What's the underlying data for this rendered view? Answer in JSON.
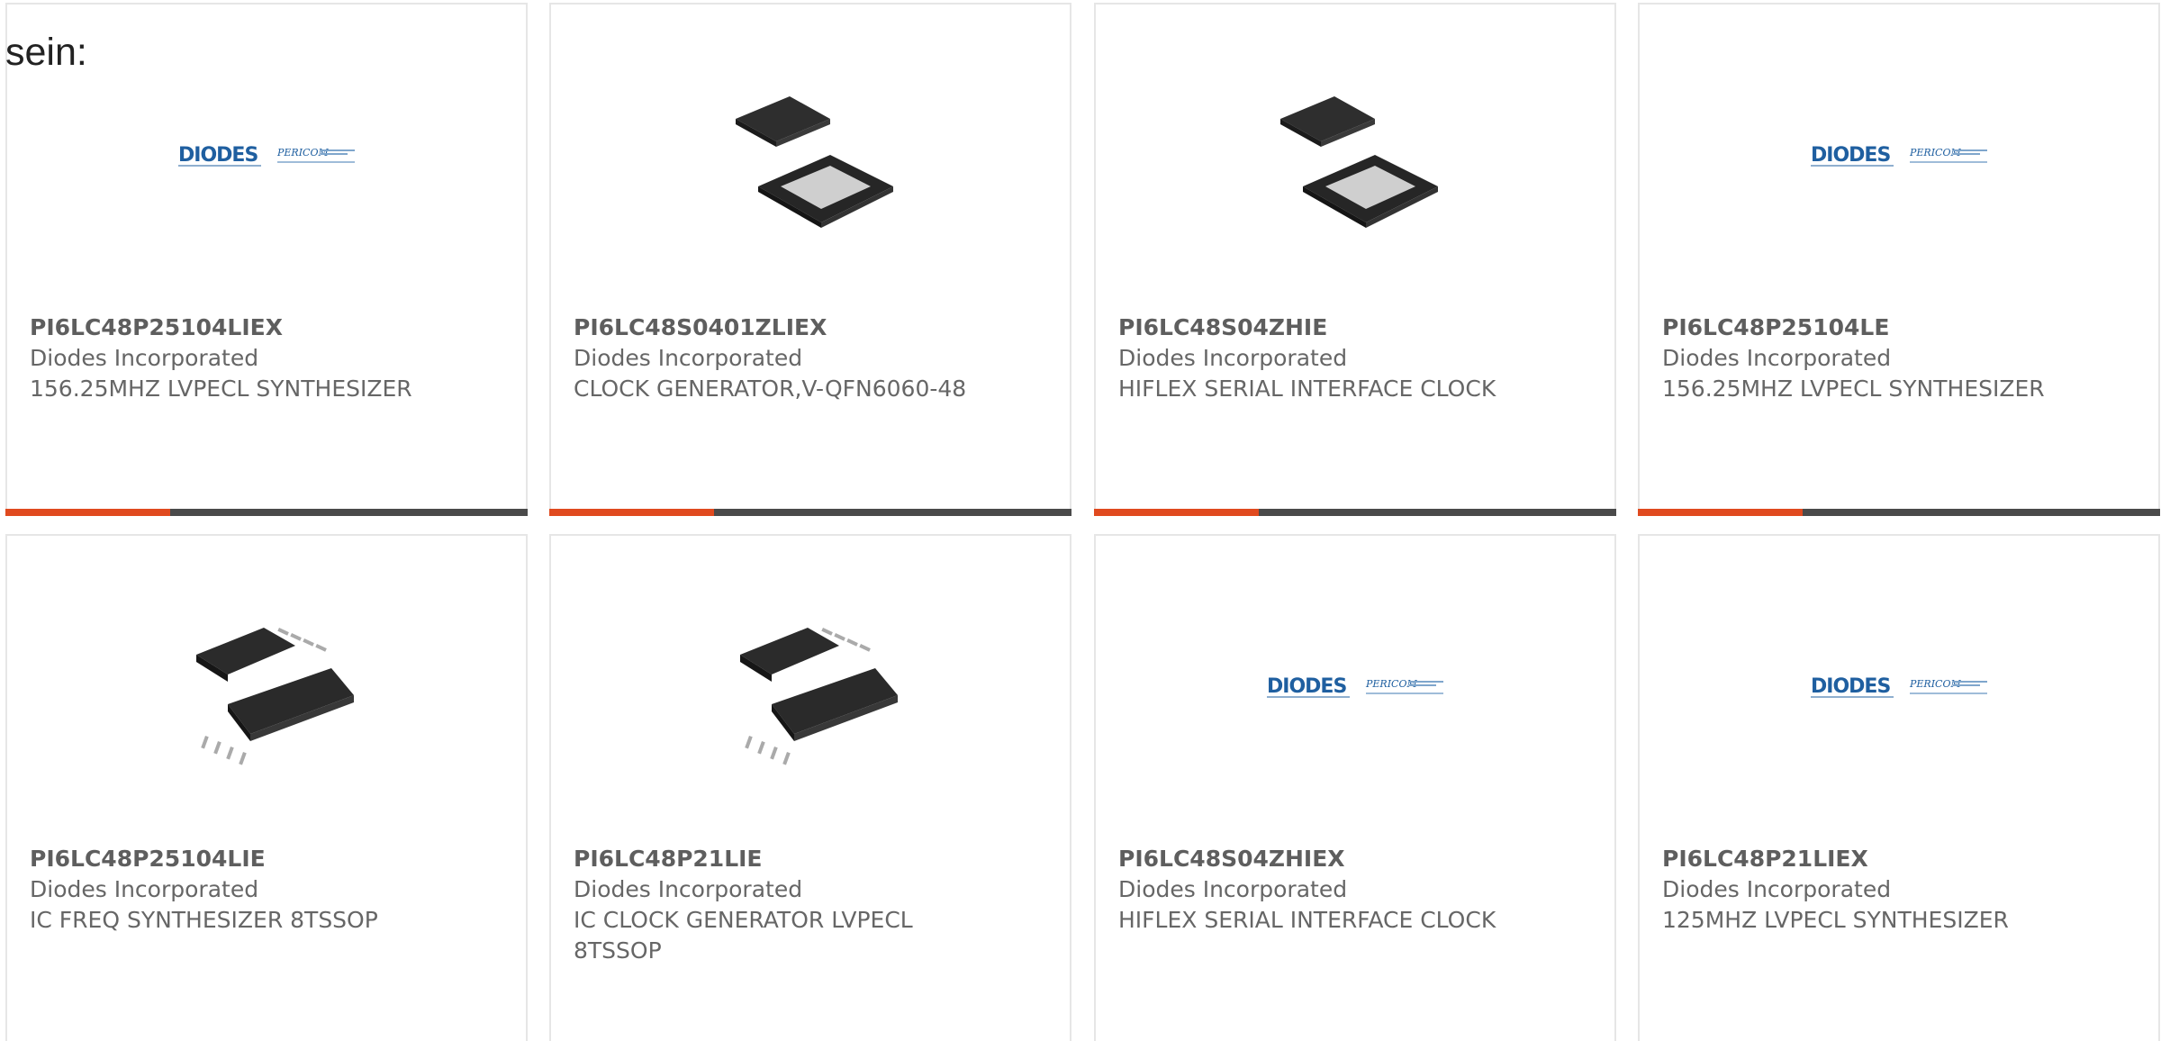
{
  "intro_text": "sein:",
  "logo_brand": "DIODES",
  "logo_subbrand": "PERICOM",
  "colors": {
    "accent": "#e04a1f",
    "bar": "#4a4a4a",
    "diodes_blue": "#1f5fa0"
  },
  "products": [
    {
      "part": "PI6LC48P25104LIEX",
      "maker": "Diodes Incorporated",
      "desc": "156.25MHZ LVPECL SYNTHESIZER",
      "image": "diodes-pericom-logo"
    },
    {
      "part": "PI6LC48S0401ZLIEX",
      "maker": "Diodes Incorporated",
      "desc": "CLOCK GENERATOR,V-QFN6060-48",
      "image": "qfn-chip"
    },
    {
      "part": "PI6LC48S04ZHIE",
      "maker": "Diodes Incorporated",
      "desc": "HIFLEX SERIAL INTERFACE CLOCK",
      "image": "qfn-chip"
    },
    {
      "part": "PI6LC48P25104LE",
      "maker": "Diodes Incorporated",
      "desc": "156.25MHZ LVPECL SYNTHESIZER",
      "image": "diodes-pericom-logo"
    },
    {
      "part": "PI6LC48P25104LIE",
      "maker": "Diodes Incorporated",
      "desc": "IC FREQ SYNTHESIZER 8TSSOP",
      "image": "tssop-chip"
    },
    {
      "part": "PI6LC48P21LIE",
      "maker": "Diodes Incorporated",
      "desc": "IC CLOCK GENERATOR LVPECL 8TSSOP",
      "image": "tssop-chip"
    },
    {
      "part": "PI6LC48S04ZHIEX",
      "maker": "Diodes Incorporated",
      "desc": "HIFLEX SERIAL INTERFACE CLOCK",
      "image": "diodes-pericom-logo"
    },
    {
      "part": "PI6LC48P21LIEX",
      "maker": "Diodes Incorporated",
      "desc": "125MHZ LVPECL SYNTHESIZER",
      "image": "diodes-pericom-logo"
    }
  ]
}
